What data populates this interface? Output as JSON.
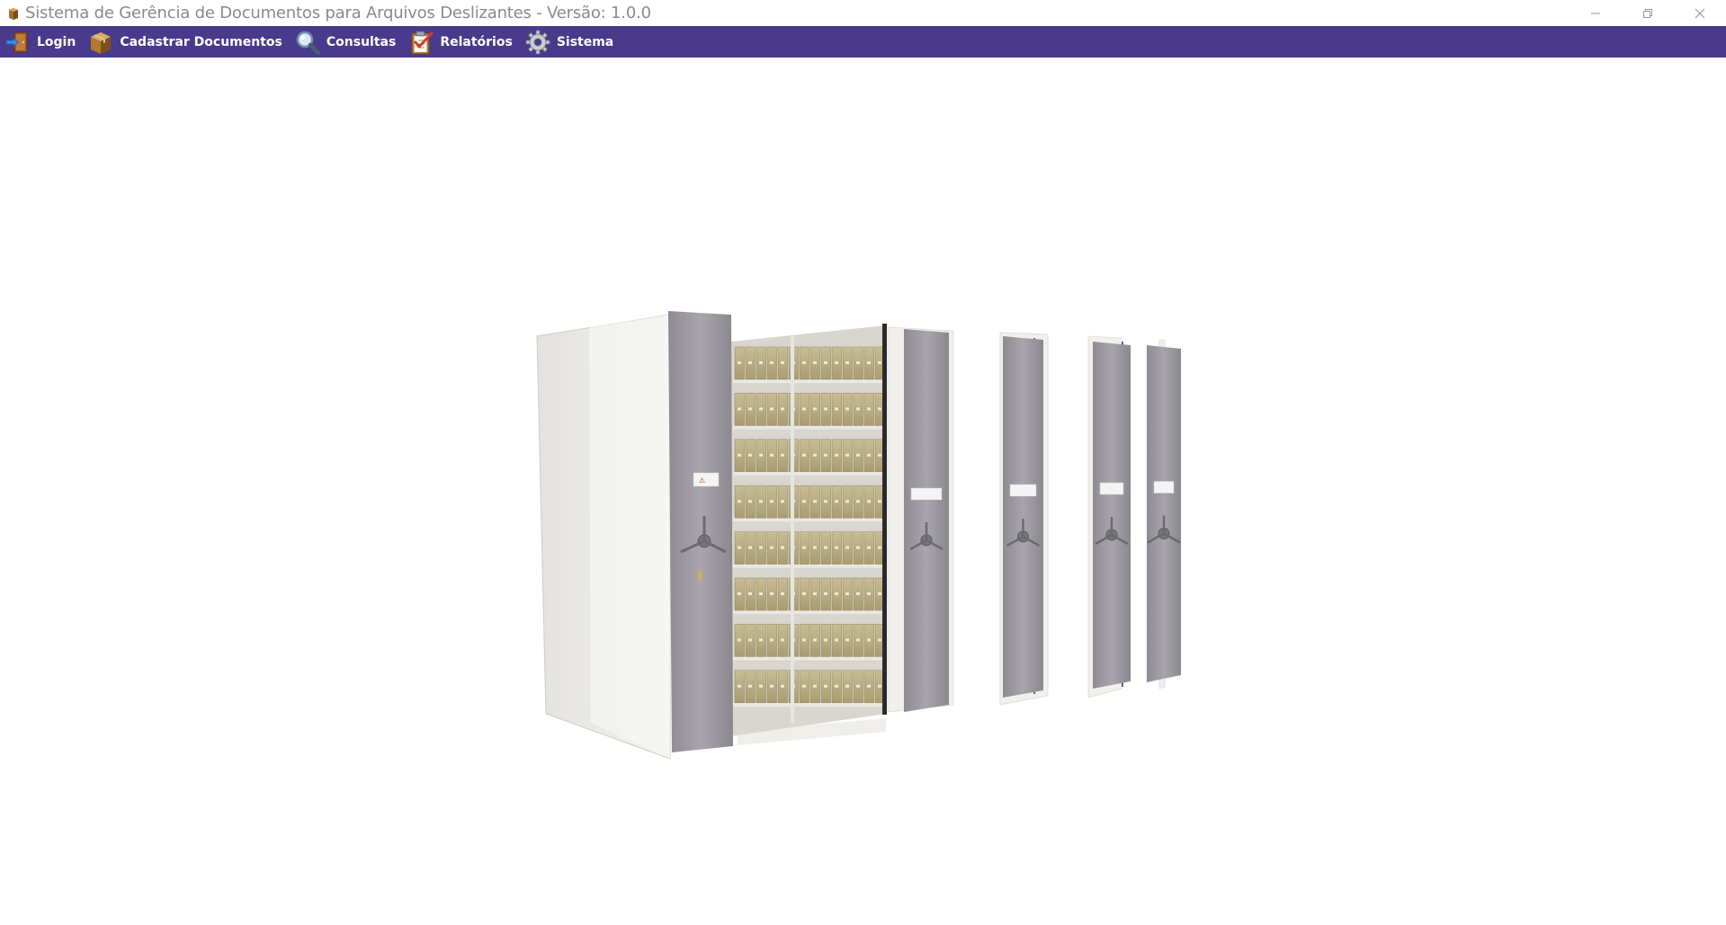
{
  "window": {
    "title": "Sistema de Gerência de Documentos para Arquivos Deslizantes - Versão: 1.0.0",
    "controls": [
      "minimize-icon",
      "restore-icon",
      "close-icon"
    ]
  },
  "menu": {
    "items": [
      {
        "label": "Login",
        "icon": "login-door-icon"
      },
      {
        "label": "Cadastrar Documentos",
        "icon": "box-icon"
      },
      {
        "label": "Consultas",
        "icon": "magnifier-icon"
      },
      {
        "label": "Relatórios",
        "icon": "clipboard-check-icon"
      },
      {
        "label": "Sistema",
        "icon": "gear-icon"
      }
    ]
  },
  "hero": {
    "image": "mobile-archive-shelving-illustration"
  },
  "colors": {
    "menubar": "#4a3a8b",
    "menu_text": "#ffffff",
    "title_text": "#8a8a8a",
    "background": "#ffffff"
  }
}
